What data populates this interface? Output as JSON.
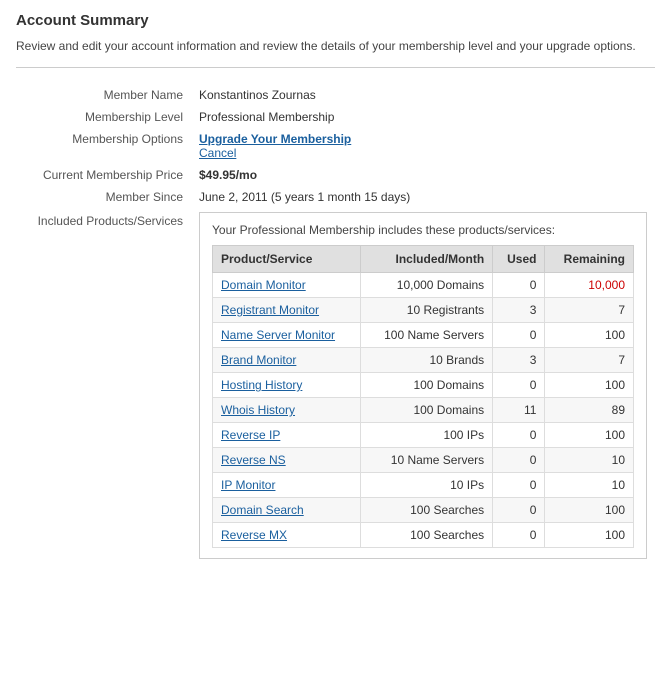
{
  "page": {
    "title": "Account Summary",
    "description": "Review and edit your account information and review the details of your membership level and your upgrade options."
  },
  "fields": [
    {
      "label": "Member Name",
      "value": "Konstantinos Zournas",
      "type": "text"
    },
    {
      "label": "Membership Level",
      "value": "Professional Membership",
      "type": "text"
    },
    {
      "label": "Membership Options",
      "value": null,
      "type": "links",
      "links": [
        {
          "text": "Upgrade Your Membership",
          "bold": true
        },
        {
          "text": "Cancel",
          "bold": false
        }
      ]
    },
    {
      "label": "Current Membership Price",
      "value": "$49.95/mo",
      "type": "price"
    },
    {
      "label": "Member Since",
      "value": "June 2, 2011 (5 years 1 month 15 days)",
      "type": "text"
    }
  ],
  "included": {
    "label": "Included Products/Services",
    "intro": "Your Professional Membership includes these products/services:",
    "columns": [
      "Product/Service",
      "Included/Month",
      "Used",
      "Remaining"
    ],
    "rows": [
      {
        "product": "Domain Monitor",
        "included": "10,000 Domains",
        "used": "0",
        "remaining": "10,000",
        "remainingRed": true
      },
      {
        "product": "Registrant Monitor",
        "included": "10 Registrants",
        "used": "3",
        "remaining": "7",
        "remainingRed": false
      },
      {
        "product": "Name Server Monitor",
        "included": "100 Name Servers",
        "used": "0",
        "remaining": "100",
        "remainingRed": false
      },
      {
        "product": "Brand Monitor",
        "included": "10 Brands",
        "used": "3",
        "remaining": "7",
        "remainingRed": false
      },
      {
        "product": "Hosting History",
        "included": "100 Domains",
        "used": "0",
        "remaining": "100",
        "remainingRed": false
      },
      {
        "product": "Whois History",
        "included": "100 Domains",
        "used": "11",
        "remaining": "89",
        "remainingRed": false
      },
      {
        "product": "Reverse IP",
        "included": "100 IPs",
        "used": "0",
        "remaining": "100",
        "remainingRed": false
      },
      {
        "product": "Reverse NS",
        "included": "10 Name Servers",
        "used": "0",
        "remaining": "10",
        "remainingRed": false
      },
      {
        "product": "IP Monitor",
        "included": "10 IPs",
        "used": "0",
        "remaining": "10",
        "remainingRed": false
      },
      {
        "product": "Domain Search",
        "included": "100 Searches",
        "used": "0",
        "remaining": "100",
        "remainingRed": false
      },
      {
        "product": "Reverse MX",
        "included": "100 Searches",
        "used": "0",
        "remaining": "100",
        "remainingRed": false
      }
    ]
  }
}
